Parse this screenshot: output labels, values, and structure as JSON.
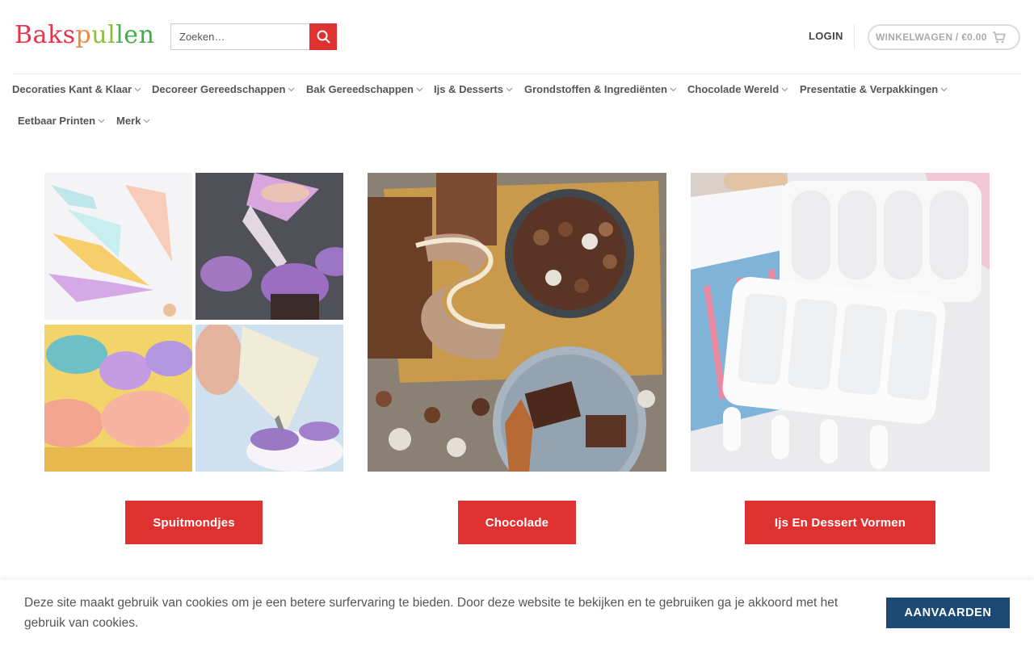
{
  "header": {
    "logo_letters": [
      "B",
      "a",
      "k",
      "s",
      "p",
      "u",
      "l",
      "l",
      "e",
      "n"
    ],
    "logo_colors": [
      "#e8334a",
      "#e8334a",
      "#e8334a",
      "#e8334a",
      "#f08a3e",
      "#8bbf3a",
      "#8bbf3a",
      "#4caf50",
      "#3fae48",
      "#3cb043"
    ],
    "search_placeholder": "Zoeken…",
    "login_label": "LOGIN",
    "cart_label": "WINKELWAGEN / €0.00"
  },
  "nav": {
    "items": [
      {
        "label": "Decoraties Kant & Klaar"
      },
      {
        "label": "Decoreer Gereedschappen"
      },
      {
        "label": "Bak Gereedschappen"
      },
      {
        "label": "Ijs & Desserts"
      },
      {
        "label": "Grondstoffen & Ingrediënten"
      },
      {
        "label": "Chocolade Wereld"
      },
      {
        "label": "Presentatie & Verpakkingen"
      },
      {
        "label": "Eetbaar Printen"
      },
      {
        "label": "Merk"
      }
    ]
  },
  "categories": [
    {
      "button": "Spuitmondjes"
    },
    {
      "button": "Chocolade"
    },
    {
      "button": "Ijs En Dessert Vormen"
    }
  ],
  "cookie": {
    "text": "Deze site maakt gebruik van cookies om je een betere surfervaring te bieden. Door deze website te bekijken en te gebruiken ga je akkoord met het gebruik van cookies.",
    "accept_label": "AANVAARDEN"
  },
  "colors": {
    "accent_red": "#e03131",
    "accept_blue": "#1d4a75"
  },
  "icons": {
    "search": "search-icon",
    "cart": "cart-icon",
    "chevron": "chevron-down-icon"
  }
}
